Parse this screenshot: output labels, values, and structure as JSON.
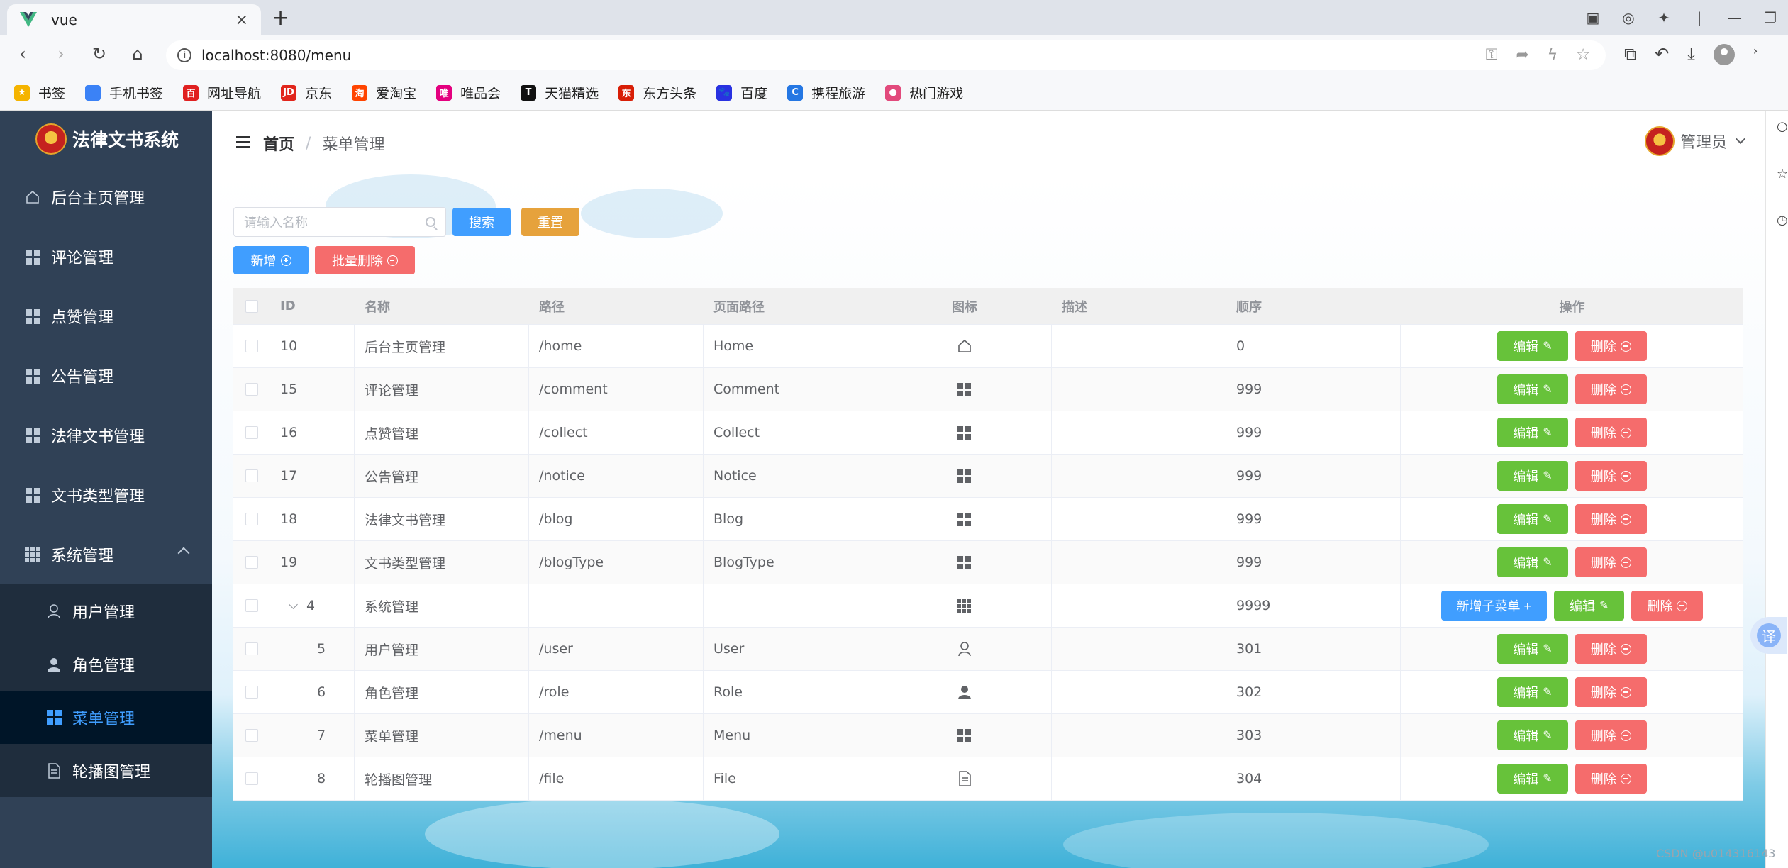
{
  "browser": {
    "tab_title": "vue",
    "tab_close": "×",
    "new_tab": "+",
    "url": "localhost:8080/menu",
    "bookmarks": [
      {
        "label": "书签",
        "icon": "star-icon",
        "color": "#f5b400",
        "glyph": "★"
      },
      {
        "label": "手机书签",
        "icon": "phone-bookmark-icon",
        "color": "#3b82f6",
        "glyph": ""
      },
      {
        "label": "网址导航",
        "icon": "navigation-icon",
        "color": "#e02020",
        "glyph": "百"
      },
      {
        "label": "京东",
        "icon": "jd-icon",
        "color": "#e1251b",
        "glyph": "JD"
      },
      {
        "label": "爱淘宝",
        "icon": "taobao-icon",
        "color": "#ff4400",
        "glyph": "淘"
      },
      {
        "label": "唯品会",
        "icon": "vip-icon",
        "color": "#e4007f",
        "glyph": "唯"
      },
      {
        "label": "天猫精选",
        "icon": "tmall-icon",
        "color": "#111111",
        "glyph": "T"
      },
      {
        "label": "东方头条",
        "icon": "toutiao-icon",
        "color": "#d81e06",
        "glyph": "东"
      },
      {
        "label": "百度",
        "icon": "baidu-icon",
        "color": "#2932e1",
        "glyph": "🐾"
      },
      {
        "label": "携程旅游",
        "icon": "ctrip-icon",
        "color": "#2577e3",
        "glyph": "C"
      },
      {
        "label": "热门游戏",
        "icon": "games-icon",
        "color": "#e24a7c",
        "glyph": "●"
      }
    ]
  },
  "app": {
    "logo_text": "法律文书系统",
    "menu": [
      {
        "label": "后台主页管理",
        "icon": "home-icon"
      },
      {
        "label": "评论管理",
        "icon": "grid-icon"
      },
      {
        "label": "点赞管理",
        "icon": "grid-icon"
      },
      {
        "label": "公告管理",
        "icon": "grid-icon"
      },
      {
        "label": "法律文书管理",
        "icon": "grid-icon"
      },
      {
        "label": "文书类型管理",
        "icon": "grid-icon"
      },
      {
        "label": "系统管理",
        "icon": "grid-nine-icon"
      }
    ],
    "submenu": [
      {
        "label": "用户管理",
        "icon": "user-icon"
      },
      {
        "label": "角色管理",
        "icon": "user-solid-icon"
      },
      {
        "label": "菜单管理",
        "icon": "grid-icon"
      },
      {
        "label": "轮播图管理",
        "icon": "document-icon"
      }
    ]
  },
  "header": {
    "breadcrumb_home": "首页",
    "breadcrumb_sep": "/",
    "breadcrumb_current": "菜单管理",
    "username": "管理员"
  },
  "toolbar": {
    "search_placeholder": "请输入名称",
    "search_label": "搜索",
    "reset_label": "重置",
    "add_label": "新增",
    "batch_delete_label": "批量删除"
  },
  "table": {
    "headers": [
      "ID",
      "名称",
      "路径",
      "页面路径",
      "图标",
      "描述",
      "顺序",
      "操作"
    ],
    "edit_label": "编辑",
    "delete_label": "删除",
    "add_child_label": "新增子菜单 +",
    "rows": [
      {
        "id": "10",
        "name": "后台主页管理",
        "path": "/home",
        "page": "Home",
        "icon": "home-icon",
        "desc": "",
        "order": "0"
      },
      {
        "id": "15",
        "name": "评论管理",
        "path": "/comment",
        "page": "Comment",
        "icon": "grid-icon",
        "desc": "",
        "order": "999"
      },
      {
        "id": "16",
        "name": "点赞管理",
        "path": "/collect",
        "page": "Collect",
        "icon": "grid-icon",
        "desc": "",
        "order": "999"
      },
      {
        "id": "17",
        "name": "公告管理",
        "path": "/notice",
        "page": "Notice",
        "icon": "grid-icon",
        "desc": "",
        "order": "999"
      },
      {
        "id": "18",
        "name": "法律文书管理",
        "path": "/blog",
        "page": "Blog",
        "icon": "grid-icon",
        "desc": "",
        "order": "999"
      },
      {
        "id": "19",
        "name": "文书类型管理",
        "path": "/blogType",
        "page": "BlogType",
        "icon": "grid-icon",
        "desc": "",
        "order": "999"
      },
      {
        "id": "4",
        "name": "系统管理",
        "path": "",
        "page": "",
        "icon": "grid-nine-icon",
        "desc": "",
        "order": "9999",
        "parent": true
      },
      {
        "id": "5",
        "name": "用户管理",
        "path": "/user",
        "page": "User",
        "icon": "user-icon",
        "desc": "",
        "order": "301",
        "child": true
      },
      {
        "id": "6",
        "name": "角色管理",
        "path": "/role",
        "page": "Role",
        "icon": "user-solid-icon",
        "desc": "",
        "order": "302",
        "child": true
      },
      {
        "id": "7",
        "name": "菜单管理",
        "path": "/menu",
        "page": "Menu",
        "icon": "grid-icon",
        "desc": "",
        "order": "303",
        "child": true
      },
      {
        "id": "8",
        "name": "轮播图管理",
        "path": "/file",
        "page": "File",
        "icon": "document-icon",
        "desc": "",
        "order": "304",
        "child": true
      }
    ]
  },
  "overlay": {
    "translate_glyph": "译",
    "watermark": "CSDN @u014316143"
  },
  "colors": {
    "sidebar_bg": "#304156",
    "primary": "#409eff",
    "success": "#67c23a",
    "danger": "#f56c6c",
    "warning": "#e6a23c"
  }
}
